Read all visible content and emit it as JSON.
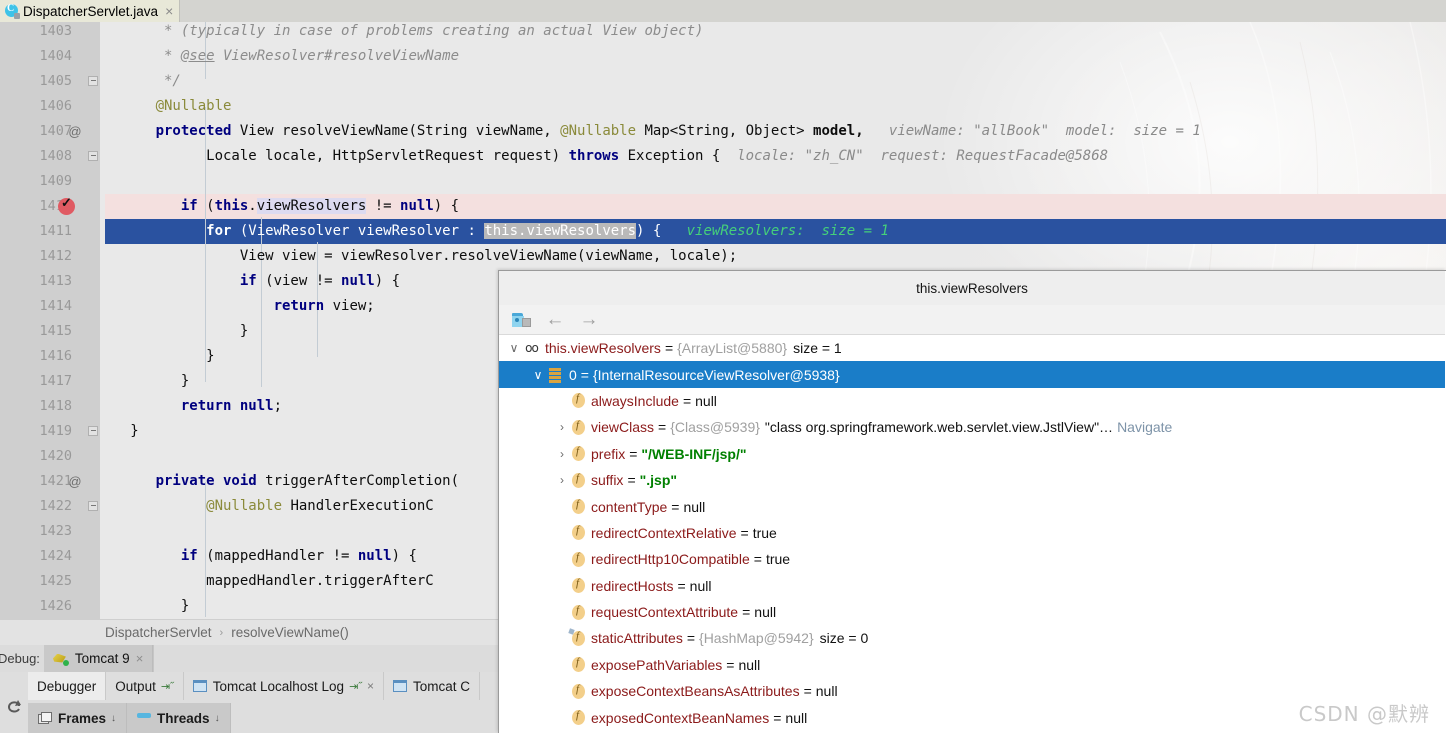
{
  "editor_tab": {
    "filename": "DispatcherServlet.java",
    "icon": "java-class-icon",
    "close": "×"
  },
  "editor": {
    "first_line_number": 1403,
    "lines": [
      {
        "n": 1403,
        "cut_top": true,
        "state": "normal",
        "mark": "",
        "fold": false,
        "segments": [
          {
            "t": "       * (typically in case of problems creating an actual View object)",
            "c": "cmt"
          }
        ]
      },
      {
        "n": 1404,
        "state": "normal",
        "mark": "",
        "fold": false,
        "segments": [
          {
            "t": "       * ",
            "c": "cmt"
          },
          {
            "t": "@see",
            "c": "cmt-link"
          },
          {
            "t": " ViewResolver#resolveViewName",
            "c": "cmt"
          }
        ]
      },
      {
        "n": 1405,
        "state": "normal",
        "mark": "",
        "fold": true,
        "segments": [
          {
            "t": "       */",
            "c": "cmt"
          }
        ]
      },
      {
        "n": 1406,
        "state": "normal",
        "mark": "",
        "fold": false,
        "segments": [
          {
            "t": "      @Nullable",
            "c": "ann"
          }
        ]
      },
      {
        "n": 1407,
        "state": "normal",
        "mark": "@",
        "fold": false,
        "segments": [
          {
            "t": "      protected",
            "c": "kw"
          },
          {
            "t": " View resolveViewName(String viewName, ",
            "c": "plain"
          },
          {
            "t": "@Nullable",
            "c": "ann"
          },
          {
            "t": " Map<String, Object> ",
            "c": "plain"
          },
          {
            "t": "model,",
            "c": "bold"
          },
          {
            "t": "   viewName: \"allBook\"  model:  size = 1",
            "c": "hint"
          }
        ]
      },
      {
        "n": 1408,
        "state": "normal",
        "mark": "",
        "fold": true,
        "segments": [
          {
            "t": "            Locale locale, HttpServletRequest request) ",
            "c": "plain"
          },
          {
            "t": "throws",
            "c": "kw"
          },
          {
            "t": " Exception {",
            "c": "plain"
          },
          {
            "t": "  locale: \"zh_CN\"  request: RequestFacade@5868",
            "c": "hint"
          }
        ]
      },
      {
        "n": 1409,
        "state": "normal",
        "mark": "",
        "fold": false,
        "segments": []
      },
      {
        "n": 1410,
        "state": "breakpoint-line",
        "mark": "breakpoint",
        "fold": false,
        "segments": [
          {
            "t": "         if",
            "c": "kw"
          },
          {
            "t": " (",
            "c": "plain"
          },
          {
            "t": "this",
            "c": "kw"
          },
          {
            "t": ".",
            "c": "plain"
          },
          {
            "t": "viewResolvers",
            "c": "field-hl"
          },
          {
            "t": " != ",
            "c": "plain"
          },
          {
            "t": "null",
            "c": "kw"
          },
          {
            "t": ") {",
            "c": "plain"
          }
        ]
      },
      {
        "n": 1411,
        "state": "executing",
        "mark": "",
        "fold": false,
        "segments": [
          {
            "t": "            for",
            "c": "kw-on-blue"
          },
          {
            "t": " (ViewResolver viewResolver : ",
            "c": "on-blue"
          },
          {
            "t": "this.viewResolvers",
            "c": "on-blue-selected"
          },
          {
            "t": ") {",
            "c": "on-blue"
          },
          {
            "t": "   viewResolvers:  size = 1",
            "c": "hint-green"
          }
        ]
      },
      {
        "n": 1412,
        "state": "normal",
        "mark": "",
        "fold": false,
        "segments": [
          {
            "t": "                View view = viewResolver.resolveViewName(viewName, locale);",
            "c": "plain"
          }
        ]
      },
      {
        "n": 1413,
        "state": "normal",
        "mark": "",
        "fold": false,
        "segments": [
          {
            "t": "                if",
            "c": "kw"
          },
          {
            "t": " (view != ",
            "c": "plain"
          },
          {
            "t": "null",
            "c": "kw"
          },
          {
            "t": ") {",
            "c": "plain"
          }
        ]
      },
      {
        "n": 1414,
        "state": "normal",
        "mark": "",
        "fold": false,
        "segments": [
          {
            "t": "                    return",
            "c": "kw"
          },
          {
            "t": " view;",
            "c": "plain"
          }
        ]
      },
      {
        "n": 1415,
        "state": "normal",
        "mark": "",
        "fold": false,
        "segments": [
          {
            "t": "                }",
            "c": "plain"
          }
        ]
      },
      {
        "n": 1416,
        "state": "normal",
        "mark": "",
        "fold": false,
        "segments": [
          {
            "t": "            }",
            "c": "plain"
          }
        ]
      },
      {
        "n": 1417,
        "state": "normal",
        "mark": "",
        "fold": false,
        "segments": [
          {
            "t": "         }",
            "c": "plain"
          }
        ]
      },
      {
        "n": 1418,
        "state": "normal",
        "mark": "",
        "fold": false,
        "segments": [
          {
            "t": "         return",
            "c": "kw"
          },
          {
            "t": " null",
            "c": "kw"
          },
          {
            "t": ";",
            "c": "plain"
          }
        ]
      },
      {
        "n": 1419,
        "state": "normal",
        "mark": "",
        "fold": true,
        "segments": [
          {
            "t": "   }",
            "c": "plain"
          }
        ]
      },
      {
        "n": 1420,
        "state": "normal",
        "mark": "",
        "fold": false,
        "segments": []
      },
      {
        "n": 1421,
        "state": "normal",
        "mark": "@",
        "fold": false,
        "segments": [
          {
            "t": "      private void",
            "c": "kw"
          },
          {
            "t": " triggerAfterCompletion(",
            "c": "plain"
          }
        ]
      },
      {
        "n": 1422,
        "state": "normal",
        "mark": "",
        "fold": true,
        "segments": [
          {
            "t": "            @Nullable",
            "c": "ann"
          },
          {
            "t": " HandlerExecutionC",
            "c": "plain"
          }
        ]
      },
      {
        "n": 1423,
        "state": "normal",
        "mark": "",
        "fold": false,
        "segments": []
      },
      {
        "n": 1424,
        "state": "normal",
        "mark": "",
        "fold": false,
        "segments": [
          {
            "t": "         if",
            "c": "kw"
          },
          {
            "t": " (mappedHandler != ",
            "c": "plain"
          },
          {
            "t": "null",
            "c": "kw"
          },
          {
            "t": ") {",
            "c": "plain"
          }
        ]
      },
      {
        "n": 1425,
        "state": "normal",
        "mark": "",
        "fold": false,
        "segments": [
          {
            "t": "            mappedHandler.triggerAfterC",
            "c": "plain"
          }
        ]
      },
      {
        "n": 1426,
        "state": "normal",
        "mark": "",
        "fold": false,
        "segments": [
          {
            "t": "         }",
            "c": "plain"
          }
        ]
      }
    ]
  },
  "breadcrumb": {
    "class": "DispatcherServlet",
    "separator": "›",
    "method": "resolveViewName()"
  },
  "debug_window": {
    "label": "Debug:",
    "run_config": "Tomcat 9",
    "run_config_close": "×",
    "tabs": [
      {
        "label": "Debugger",
        "active": true,
        "icon": "",
        "pin": "",
        "close": ""
      },
      {
        "label": "Output",
        "active": false,
        "icon": "",
        "pin": "⇥˝",
        "close": ""
      },
      {
        "label": "Tomcat Localhost Log",
        "active": false,
        "icon": "log-icon",
        "pin": "⇥˝",
        "close": "×"
      },
      {
        "label": "Tomcat C",
        "active": false,
        "icon": "log-icon",
        "pin": "",
        "close": ""
      }
    ],
    "subtabs": [
      {
        "label": "Frames",
        "icon": "frames-icon",
        "chev": "↓"
      },
      {
        "label": "Threads",
        "icon": "threads-icon",
        "chev": "↓"
      }
    ]
  },
  "popup": {
    "title": "this.viewResolvers",
    "toolbar": [
      {
        "name": "group-by-icon",
        "glyph": ""
      },
      {
        "name": "back-arrow-icon",
        "glyph": "←"
      },
      {
        "name": "forward-arrow-icon",
        "glyph": "→"
      }
    ],
    "tree": [
      {
        "depth": 0,
        "twist": "∨",
        "icon": "oo",
        "icon_glyph": "∞",
        "name": "this.viewResolvers",
        "name_color": "red",
        "eq": "=",
        "ref": "{ArrayList@5880}",
        "value": "",
        "str": "",
        "size": "size = 1",
        "nav": "",
        "selected": false
      },
      {
        "depth": 1,
        "twist": "∨",
        "icon": "list",
        "icon_glyph": "",
        "name": "0",
        "name_color": "plain",
        "eq": "=",
        "ref": "{InternalResourceViewResolver@5938}",
        "value": "",
        "str": "",
        "size": "",
        "nav": "",
        "selected": true
      },
      {
        "depth": 2,
        "twist": "",
        "icon": "f",
        "icon_glyph": "f",
        "name": "alwaysInclude",
        "name_color": "red",
        "eq": "=",
        "ref": "",
        "value": "null",
        "str": "",
        "size": "",
        "nav": "",
        "selected": false
      },
      {
        "depth": 2,
        "twist": "›",
        "icon": "f",
        "icon_glyph": "f",
        "name": "viewClass",
        "name_color": "red",
        "eq": "=",
        "ref": "{Class@5939}",
        "value": "",
        "str": "\"class org.springframework.web.servlet.view.JstlView\"…",
        "size": "",
        "nav": "Navigate",
        "selected": false,
        "str_plain": true
      },
      {
        "depth": 2,
        "twist": "›",
        "icon": "f",
        "icon_glyph": "f",
        "name": "prefix",
        "name_color": "red",
        "eq": "=",
        "ref": "",
        "value": "",
        "str": "\"/WEB-INF/jsp/\"",
        "size": "",
        "nav": "",
        "selected": false
      },
      {
        "depth": 2,
        "twist": "›",
        "icon": "f",
        "icon_glyph": "f",
        "name": "suffix",
        "name_color": "red",
        "eq": "=",
        "ref": "",
        "value": "",
        "str": "\".jsp\"",
        "size": "",
        "nav": "",
        "selected": false
      },
      {
        "depth": 2,
        "twist": "",
        "icon": "f",
        "icon_glyph": "f",
        "name": "contentType",
        "name_color": "red",
        "eq": "=",
        "ref": "",
        "value": "null",
        "str": "",
        "size": "",
        "nav": "",
        "selected": false
      },
      {
        "depth": 2,
        "twist": "",
        "icon": "f",
        "icon_glyph": "f",
        "name": "redirectContextRelative",
        "name_color": "red",
        "eq": "=",
        "ref": "",
        "value": "true",
        "str": "",
        "size": "",
        "nav": "",
        "selected": false
      },
      {
        "depth": 2,
        "twist": "",
        "icon": "f",
        "icon_glyph": "f",
        "name": "redirectHttp10Compatible",
        "name_color": "red",
        "eq": "=",
        "ref": "",
        "value": "true",
        "str": "",
        "size": "",
        "nav": "",
        "selected": false
      },
      {
        "depth": 2,
        "twist": "",
        "icon": "f",
        "icon_glyph": "f",
        "name": "redirectHosts",
        "name_color": "red",
        "eq": "=",
        "ref": "",
        "value": "null",
        "str": "",
        "size": "",
        "nav": "",
        "selected": false
      },
      {
        "depth": 2,
        "twist": "",
        "icon": "f",
        "icon_glyph": "f",
        "name": "requestContextAttribute",
        "name_color": "red",
        "eq": "=",
        "ref": "",
        "value": "null",
        "str": "",
        "size": "",
        "nav": "",
        "selected": false
      },
      {
        "depth": 2,
        "twist": "",
        "icon": "f-static",
        "icon_glyph": "f",
        "name": "staticAttributes",
        "name_color": "red",
        "eq": "=",
        "ref": "{HashMap@5942}",
        "value": "",
        "str": "",
        "size": "size = 0",
        "nav": "",
        "selected": false
      },
      {
        "depth": 2,
        "twist": "",
        "icon": "f",
        "icon_glyph": "f",
        "name": "exposePathVariables",
        "name_color": "red",
        "eq": "=",
        "ref": "",
        "value": "null",
        "str": "",
        "size": "",
        "nav": "",
        "selected": false
      },
      {
        "depth": 2,
        "twist": "",
        "icon": "f",
        "icon_glyph": "f",
        "name": "exposeContextBeansAsAttributes",
        "name_color": "red",
        "eq": "=",
        "ref": "",
        "value": "null",
        "str": "",
        "size": "",
        "nav": "",
        "selected": false
      },
      {
        "depth": 2,
        "twist": "",
        "icon": "f",
        "icon_glyph": "f",
        "name": "exposedContextBeanNames",
        "name_color": "red",
        "eq": "=",
        "ref": "",
        "value": "null",
        "str": "",
        "size": "",
        "nav": "",
        "selected": false
      }
    ]
  },
  "watermark": "CSDN @默辨",
  "colors": {
    "execution_line": "#2a52a0",
    "breakpoint_line": "#f4e0df",
    "selection_blue": "#1a7dc8",
    "keyword": "#00007f",
    "string": "#008000",
    "field_name": "#8b1a1a",
    "inline_hint": "#8a8a8a",
    "inline_hint_on_exec": "#45d07a"
  }
}
